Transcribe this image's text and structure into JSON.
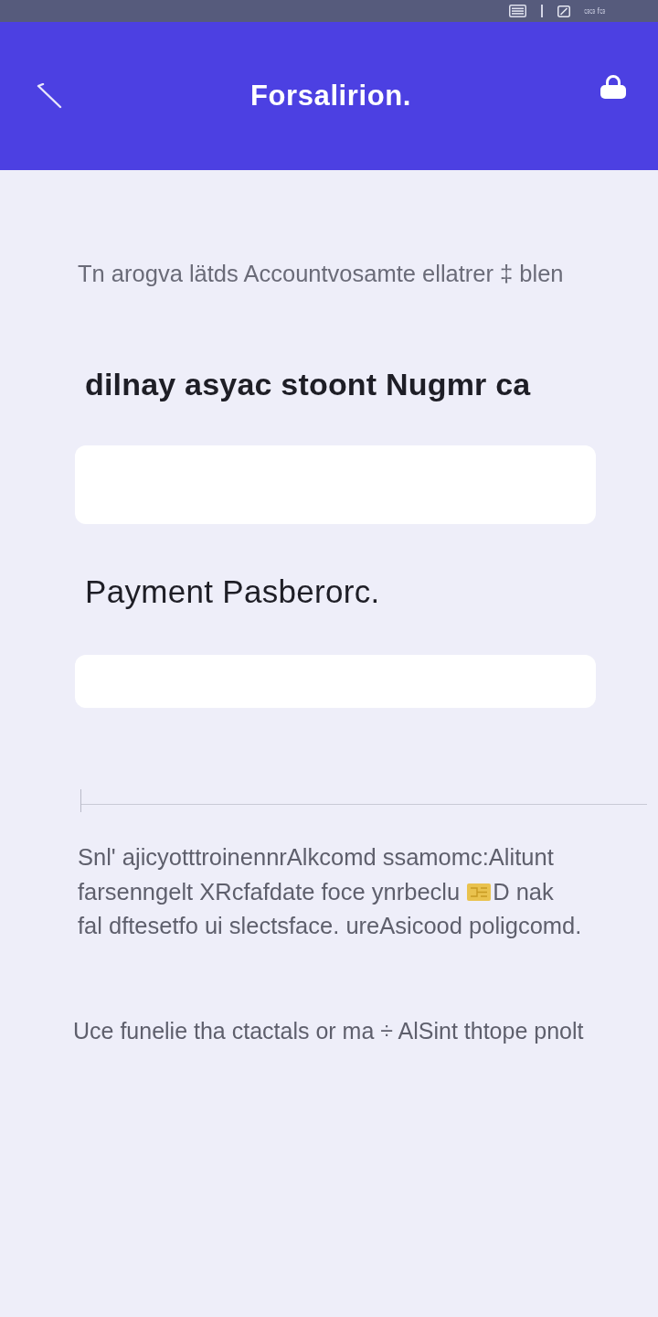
{
  "status_bar": {
    "text": "ශශ fශ"
  },
  "header": {
    "title": "Forsalirion."
  },
  "intro": "Tn arogva lätds Accountvosamte ellatrer ‡ blen",
  "fields": [
    {
      "label": "dilnay asyac stoont Nugmr ca",
      "kind": "textarea"
    },
    {
      "label": "Payment Pasberorc.",
      "kind": "password"
    }
  ],
  "note_lines": [
    [
      {
        "kind": "text",
        "text": "Snl' ajicyotttroinennrAlkcomd ssamomc:Alitunt"
      }
    ],
    [
      {
        "kind": "text",
        "text": "farsenngelt XRcfafdate foce ynrbeclu"
      },
      {
        "kind": "chip"
      },
      {
        "kind": "text",
        "text": "D nak"
      }
    ],
    [
      {
        "kind": "text",
        "text": "fal dftesetfo ui slectsface. ureAsicood poligcomd."
      }
    ]
  ],
  "footer_text": "Uce funelie tha ctactals or ma ÷ AlSint thtope pnolt"
}
